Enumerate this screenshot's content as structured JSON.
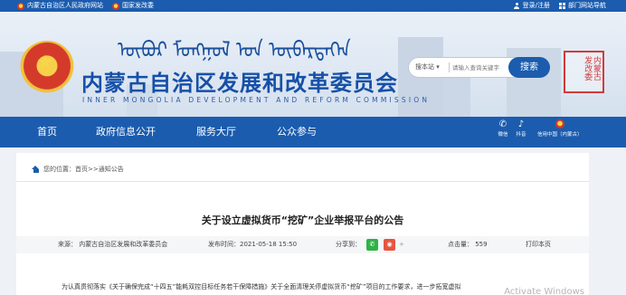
{
  "topbar": {
    "gov_site": "内蒙古自治区人民政府网站",
    "gov_portal": "国家发改委",
    "login": "登录/注册",
    "dept_nav": "部门网站导航"
  },
  "header": {
    "mongolian_script": "ᠥᠪᠥᠷ ᠮᠣᠩᠭᠣᠯ ᠤᠨ ᠥᠪᠡᠷᠲᠡᠭᠡᠨ",
    "title": "内蒙古自治区发展和改革委员会",
    "subtitle": "INNER MONGOLIA DEVELOPMENT AND REFORM COMMISSION",
    "search_scope": "搜本站 ▾",
    "search_placeholder": "请输入查询关键字",
    "search_button": "搜索",
    "seal_text": "内蒙古发改委"
  },
  "nav": {
    "items": [
      "首页",
      "政府信息公开",
      "服务大厅",
      "公众参与"
    ],
    "wechat": "微信",
    "douyin": "抖音",
    "xinyong": "信用中国（内蒙古）"
  },
  "content": {
    "breadcrumb": "您的位置：首页>>通知公告",
    "title": "关于设立虚拟货币“挖矿”企业举报平台的公告",
    "meta": {
      "source": "来源：  内蒙古自治区发展和改革委员会",
      "published": "发布时间：2021-05-18 15:50",
      "share_label": "分享到：",
      "clicks": "点击量：  559",
      "print": "打印本页"
    },
    "body": "为认真贯彻落实《关于确保完成“十四五”能耗双控目标任务若干保障措施》关于全面清理关停虚拟货币“挖矿”项目的工作要求，进一步拓宽虚拟",
    "watermark": "Activate Windows"
  },
  "colors": {
    "primary": "#1b5cae",
    "wechat": "#2fb245",
    "weibo": "#e6553f"
  }
}
